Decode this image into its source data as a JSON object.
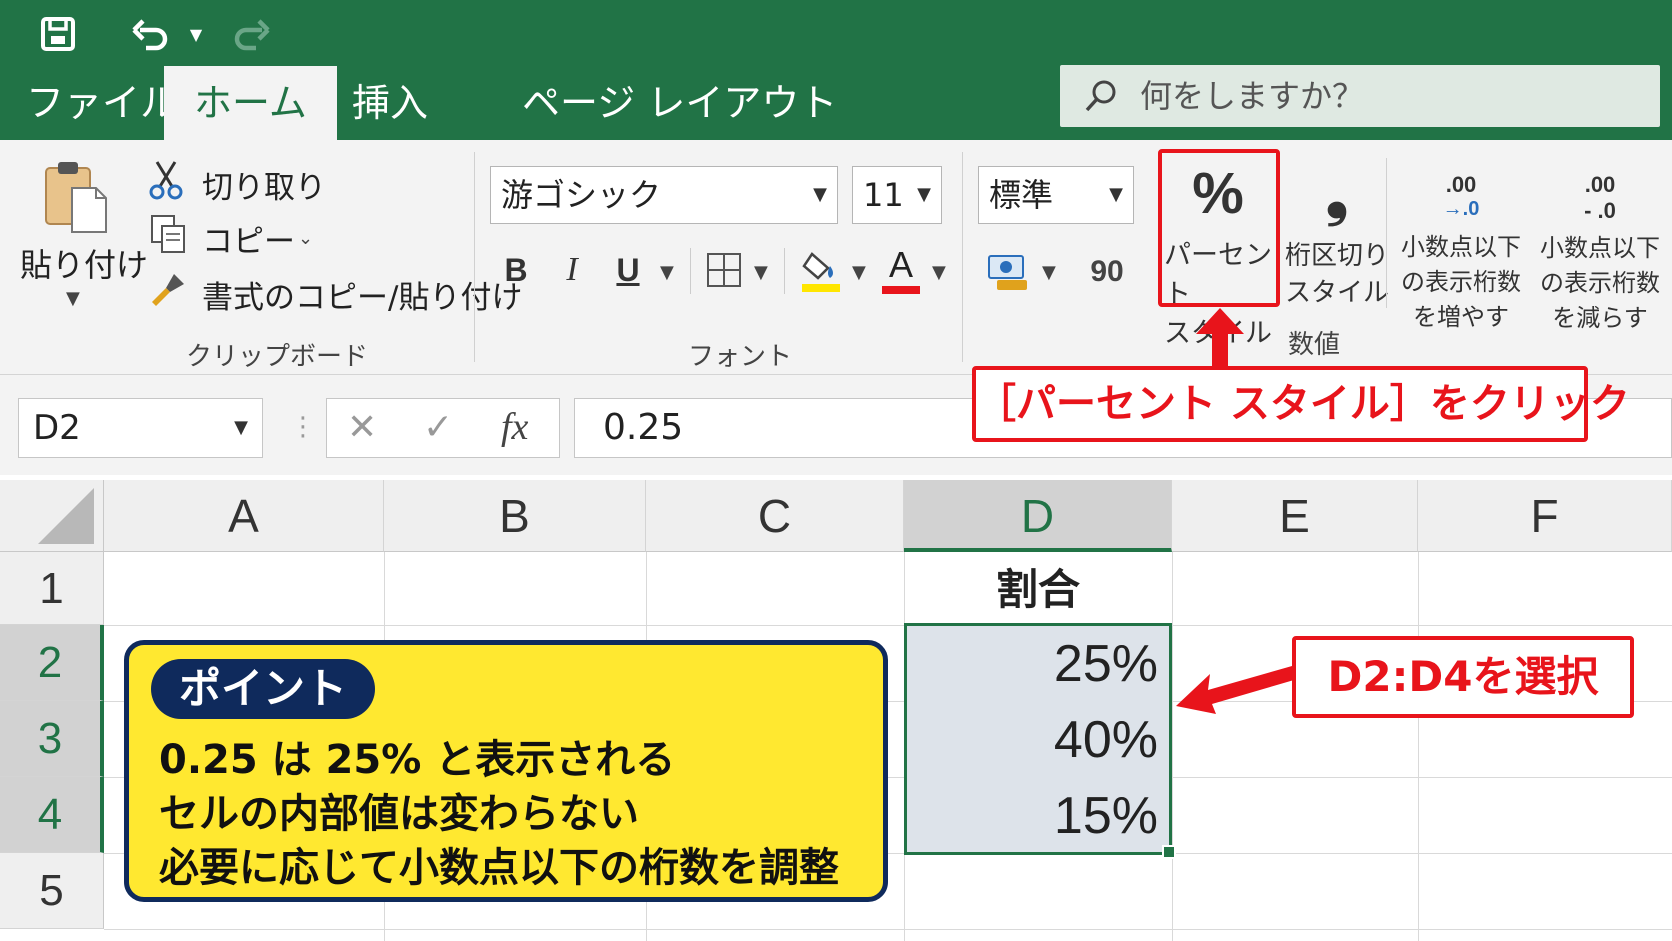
{
  "quick_access": {
    "save_icon": "save-icon",
    "undo_icon": "undo-icon",
    "redo_icon": "redo-icon"
  },
  "tabs": [
    {
      "label": "ファイル",
      "active": false
    },
    {
      "label": "ホーム",
      "active": true
    },
    {
      "label": "挿入",
      "active": false
    },
    {
      "label": "ページ レイアウト",
      "active": false
    }
  ],
  "search": {
    "placeholder": "何をしますか？"
  },
  "ribbon": {
    "clipboard": {
      "paste_label": "貼り付け",
      "cut_label": "切り取り",
      "copy_label": "コピー",
      "format_painter_label": "書式のコピー/貼り付け",
      "group_label": "クリップボード"
    },
    "font": {
      "font_name": "游ゴシック",
      "font_size": "11",
      "bold": "B",
      "italic": "I",
      "underline": "U",
      "font_color_glyph": "A",
      "group_label": "フォント"
    },
    "number": {
      "format": "標準",
      "comma_glyph": "90",
      "percent_glyph": "%",
      "percent_label_1": "パーセント",
      "percent_label_2": "スタイル",
      "comma_style_glyph": "❟",
      "comma_style_label_1": "桁区切り",
      "comma_style_label_2": "スタイル",
      "increase_decimal_glyph": ".00",
      "increase_decimal_sub": "→.0",
      "increase_decimal_label_1": "小数点以下",
      "increase_decimal_label_2": "の表示桁数",
      "increase_decimal_label_3": "を増やす",
      "decrease_decimal_glyph": ".00",
      "decrease_decimal_sub": "- .0",
      "decrease_decimal_label_1": "小数点以下",
      "decrease_decimal_label_2": "の表示桁数",
      "decrease_decimal_label_3": "を減らす",
      "group_label": "数値"
    }
  },
  "formula_bar": {
    "name_box": "D2",
    "cancel_glyph": "✕",
    "enter_glyph": "✓",
    "fx_glyph": "fx",
    "value": "0.25"
  },
  "grid": {
    "columns": [
      "A",
      "B",
      "C",
      "D",
      "E",
      "F"
    ],
    "selected_column": "D",
    "rows": [
      "1",
      "2",
      "3",
      "4",
      "5"
    ],
    "selected_rows": [
      "2",
      "3",
      "4"
    ],
    "header_cell": "割合",
    "values": [
      "25%",
      "40%",
      "15%"
    ]
  },
  "annotations": {
    "percent_callout": "［パーセント スタイル］をクリック",
    "range_callout": "D2:D4を選択",
    "point_title": "ポイント",
    "point_lines": [
      "0.25 は  25% と表示される",
      "セルの内部値は変わらない",
      "必要に応じて小数点以下の桁数を調整"
    ]
  },
  "colors": {
    "excel_green": "#217346",
    "callout_red": "#e8141b",
    "point_yellow": "#ffe830",
    "point_navy": "#0f2a5c",
    "selection_fill": "#dde3ea"
  }
}
